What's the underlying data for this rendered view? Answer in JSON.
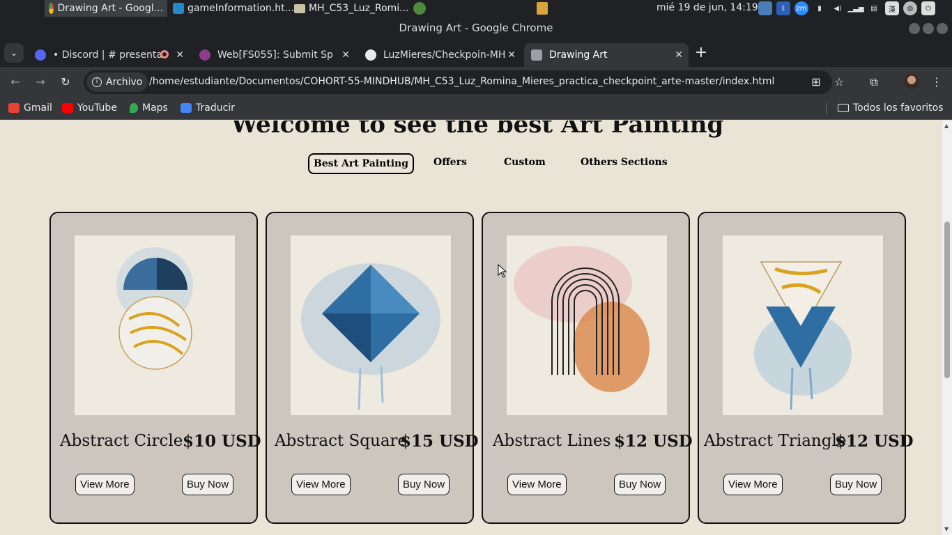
{
  "os_panel": {
    "tasks": [
      {
        "label": "Drawing Art - Googl...",
        "icon": "chrome-icon",
        "active": true
      },
      {
        "label": "gameInformation.ht...",
        "icon": "vscode-icon"
      },
      {
        "label": "MH_C53_Luz_Romi...",
        "icon": "folder-icon"
      }
    ],
    "clock": "mié 19 de jun, 14:19"
  },
  "window": {
    "title": "Drawing Art - Google Chrome"
  },
  "tabs": [
    {
      "label": "• Discord | #    presenta",
      "icon": "discord-icon"
    },
    {
      "label": "Web[FS055]:    Submit Sp",
      "icon": "web-icon"
    },
    {
      "label": "LuzMieres/Checkpoin-MH",
      "icon": "github-icon"
    },
    {
      "label": "Drawing Art",
      "icon": "page-icon",
      "active": true
    }
  ],
  "toolbar": {
    "security_chip": "Archivo",
    "url": "/home/estudiante/Documentos/COHORT-55-MINDHUB/MH_C53_Luz_Romina_Mieres_practica_checkpoint_arte-master/index.html"
  },
  "bookmarks": [
    {
      "label": "Gmail",
      "icon": "gmail-icon",
      "color": "#ea4335"
    },
    {
      "label": "YouTube",
      "icon": "youtube-icon",
      "color": "#ff0000"
    },
    {
      "label": "Maps",
      "icon": "maps-icon",
      "color": "#34a853"
    },
    {
      "label": "Traducir",
      "icon": "translate-icon",
      "color": "#4285f4"
    }
  ],
  "all_bookmarks": "Todos los favoritos",
  "page": {
    "heading": "Welcome to see the best Art Painting",
    "nav": [
      "Best Art Painting",
      "Offers",
      "Custom",
      "Others Sections"
    ],
    "products": [
      {
        "name": "Abstract Circle",
        "price": "$10 USD",
        "view": "View More",
        "buy": "Buy Now"
      },
      {
        "name": "Abstract Square",
        "price": "$15 USD",
        "view": "View More",
        "buy": "Buy Now"
      },
      {
        "name": "Abstract Lines",
        "price": "$12 USD",
        "view": "View More",
        "buy": "Buy Now"
      },
      {
        "name": "Abstract Triangle",
        "price": "$12 USD",
        "view": "View More",
        "buy": "Buy Now"
      }
    ]
  }
}
